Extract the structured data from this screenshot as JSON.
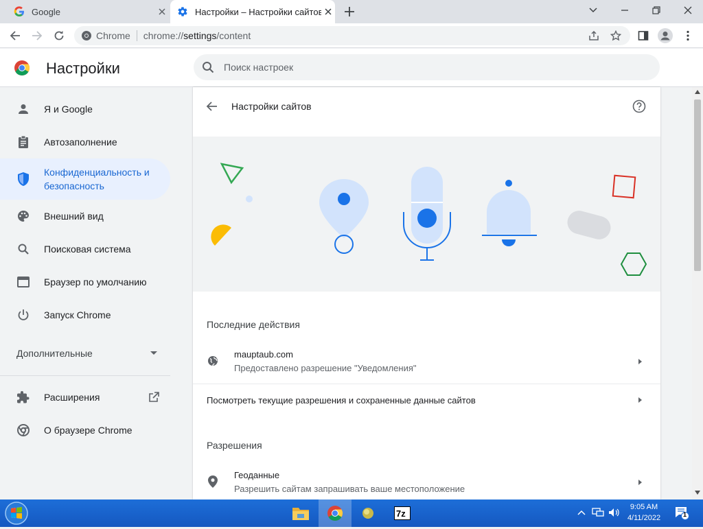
{
  "tabs": [
    {
      "title": "Google"
    },
    {
      "title": "Настройки – Настройки сайтов"
    }
  ],
  "omnibox": {
    "site_label": "Chrome",
    "url_scheme": "chrome://",
    "url_host": "settings",
    "url_path": "/content"
  },
  "header": {
    "title": "Настройки",
    "search_placeholder": "Поиск настроек"
  },
  "sidebar": {
    "items": [
      {
        "label": "Я и Google",
        "icon": "person-icon"
      },
      {
        "label": "Автозаполнение",
        "icon": "clipboard-icon"
      },
      {
        "label": "Конфиденциальность и безопасность",
        "icon": "shield-icon",
        "active": true
      },
      {
        "label": "Внешний вид",
        "icon": "palette-icon"
      },
      {
        "label": "Поисковая система",
        "icon": "search-icon"
      },
      {
        "label": "Браузер по умолчанию",
        "icon": "browser-icon"
      },
      {
        "label": "Запуск Chrome",
        "icon": "power-icon"
      }
    ],
    "advanced_label": "Дополнительные",
    "extensions_label": "Расширения",
    "about_label": "О браузере Chrome"
  },
  "main": {
    "title": "Настройки сайтов",
    "recent_heading": "Последние действия",
    "recent_site": "mauptaub.com",
    "recent_desc": "Предоставлено разрешение \"Уведомления\"",
    "view_permissions": "Посмотреть текущие разрешения и сохраненные данные сайтов",
    "permissions_heading": "Разрешения",
    "location_title": "Геоданные",
    "location_desc": "Разрешить сайтам запрашивать ваше местоположение"
  },
  "taskbar": {
    "time": "9:05 AM",
    "date": "4/11/2022",
    "notification_count": "1"
  },
  "colors": {
    "accent": "#1a73e8",
    "active_bg": "#e8f0fe"
  }
}
